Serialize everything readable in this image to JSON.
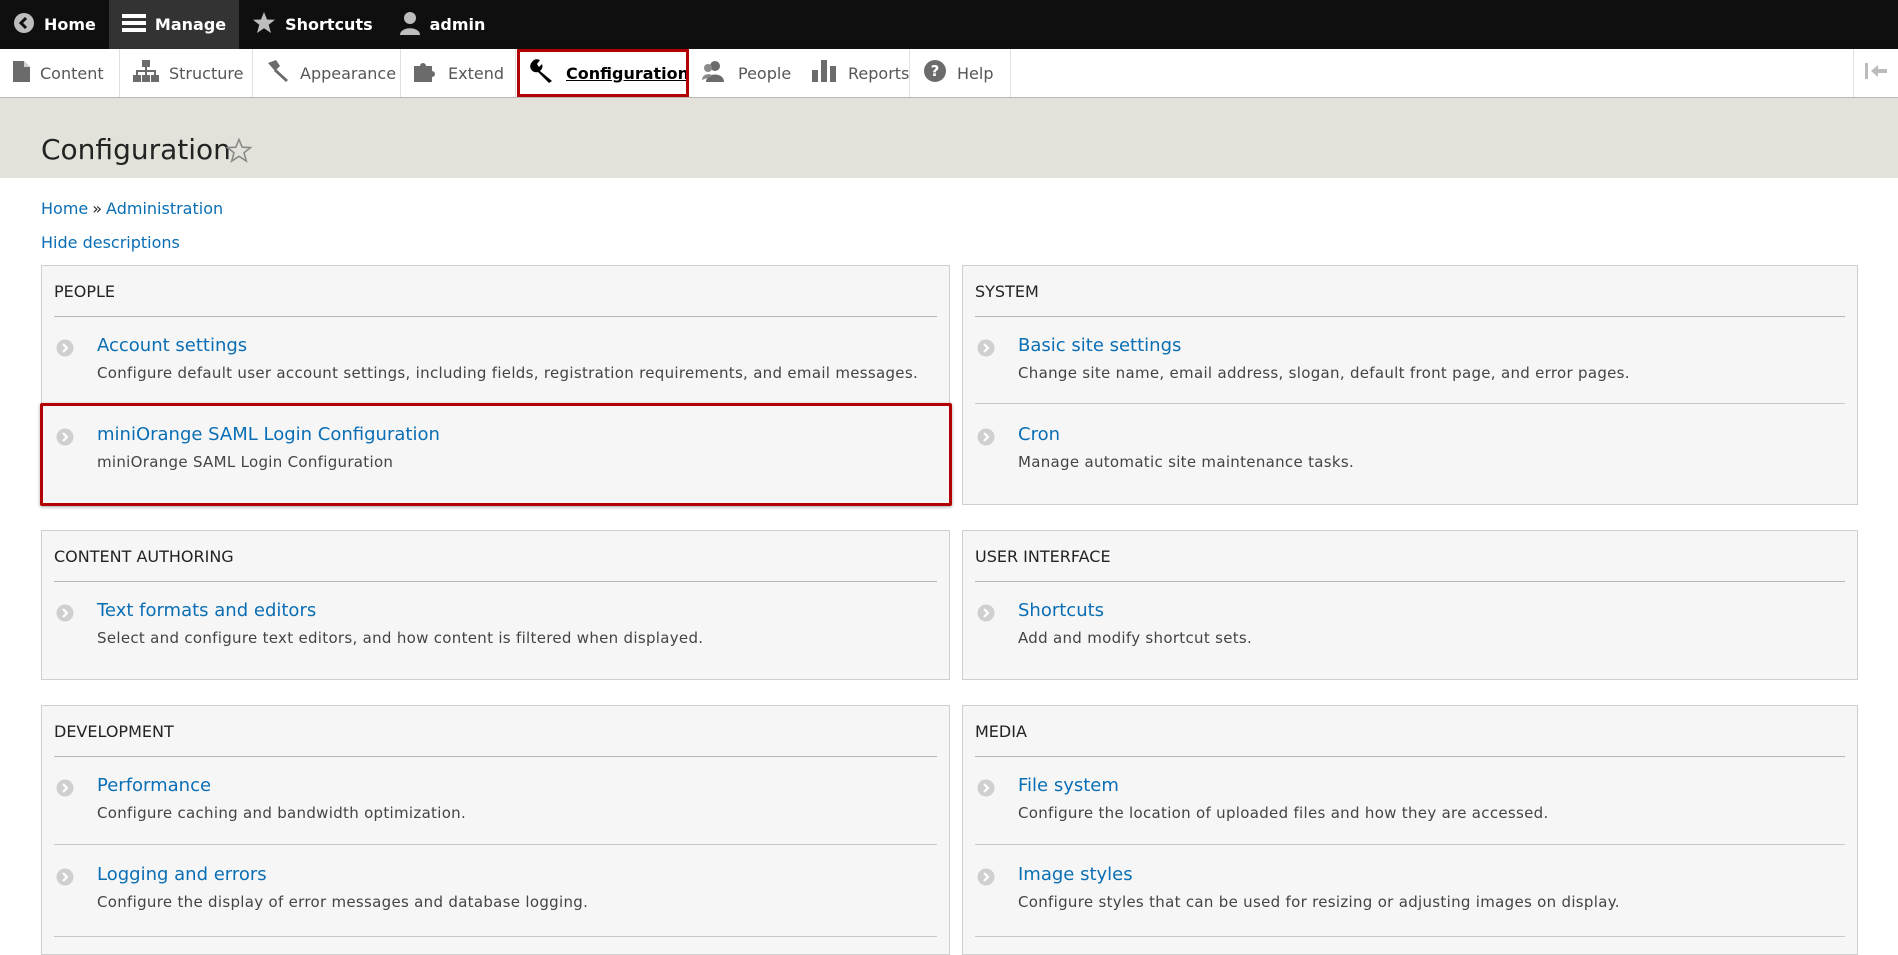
{
  "toolbar": {
    "items": [
      {
        "label": "Home",
        "icon": "back-circle-icon"
      },
      {
        "label": "Manage",
        "icon": "hamburger-icon"
      },
      {
        "label": "Shortcuts",
        "icon": "star-icon"
      },
      {
        "label": "admin",
        "icon": "user-icon"
      }
    ]
  },
  "tray": {
    "items": [
      {
        "label": "Content",
        "icon": "file-icon"
      },
      {
        "label": "Structure",
        "icon": "sitemap-icon"
      },
      {
        "label": "Appearance",
        "icon": "paint-brush-icon"
      },
      {
        "label": "Extend",
        "icon": "puzzle-icon"
      },
      {
        "label": "Configuration",
        "icon": "wrench-icon"
      },
      {
        "label": "People",
        "icon": "people-icon"
      },
      {
        "label": "Reports",
        "icon": "bar-chart-icon"
      },
      {
        "label": "Help",
        "icon": "help-icon"
      }
    ],
    "active": "Configuration",
    "highlight_color": "#b30000"
  },
  "page": {
    "title": "Configuration"
  },
  "breadcrumb": {
    "home": "Home",
    "separator": "»",
    "admin": "Administration"
  },
  "hide_descriptions": "Hide descriptions",
  "panels": {
    "people": {
      "title": "PEOPLE",
      "entries": [
        {
          "title": "Account settings",
          "desc": "Configure default user account settings, including fields, registration requirements, and email messages."
        },
        {
          "title": "miniOrange SAML Login Configuration",
          "desc": "miniOrange SAML Login Configuration"
        }
      ]
    },
    "system": {
      "title": "SYSTEM",
      "entries": [
        {
          "title": "Basic site settings",
          "desc": "Change site name, email address, slogan, default front page, and error pages."
        },
        {
          "title": "Cron",
          "desc": "Manage automatic site maintenance tasks."
        }
      ]
    },
    "content_authoring": {
      "title": "CONTENT AUTHORING",
      "entries": [
        {
          "title": "Text formats and editors",
          "desc": "Select and configure text editors, and how content is filtered when displayed."
        }
      ]
    },
    "user_interface": {
      "title": "USER INTERFACE",
      "entries": [
        {
          "title": "Shortcuts",
          "desc": "Add and modify shortcut sets."
        }
      ]
    },
    "development": {
      "title": "DEVELOPMENT",
      "entries": [
        {
          "title": "Performance",
          "desc": "Configure caching and bandwidth optimization."
        },
        {
          "title": "Logging and errors",
          "desc": "Configure the display of error messages and database logging."
        }
      ]
    },
    "media": {
      "title": "MEDIA",
      "entries": [
        {
          "title": "File system",
          "desc": "Configure the location of uploaded files and how they are accessed."
        },
        {
          "title": "Image styles",
          "desc": "Configure styles that can be used for resizing or adjusting images on display."
        }
      ]
    }
  },
  "colors": {
    "link": "#0a6eb4",
    "toolbar_bg": "#0f0f0f",
    "header_bg": "#e2e2da",
    "panel_bg": "#f6f6f6"
  }
}
